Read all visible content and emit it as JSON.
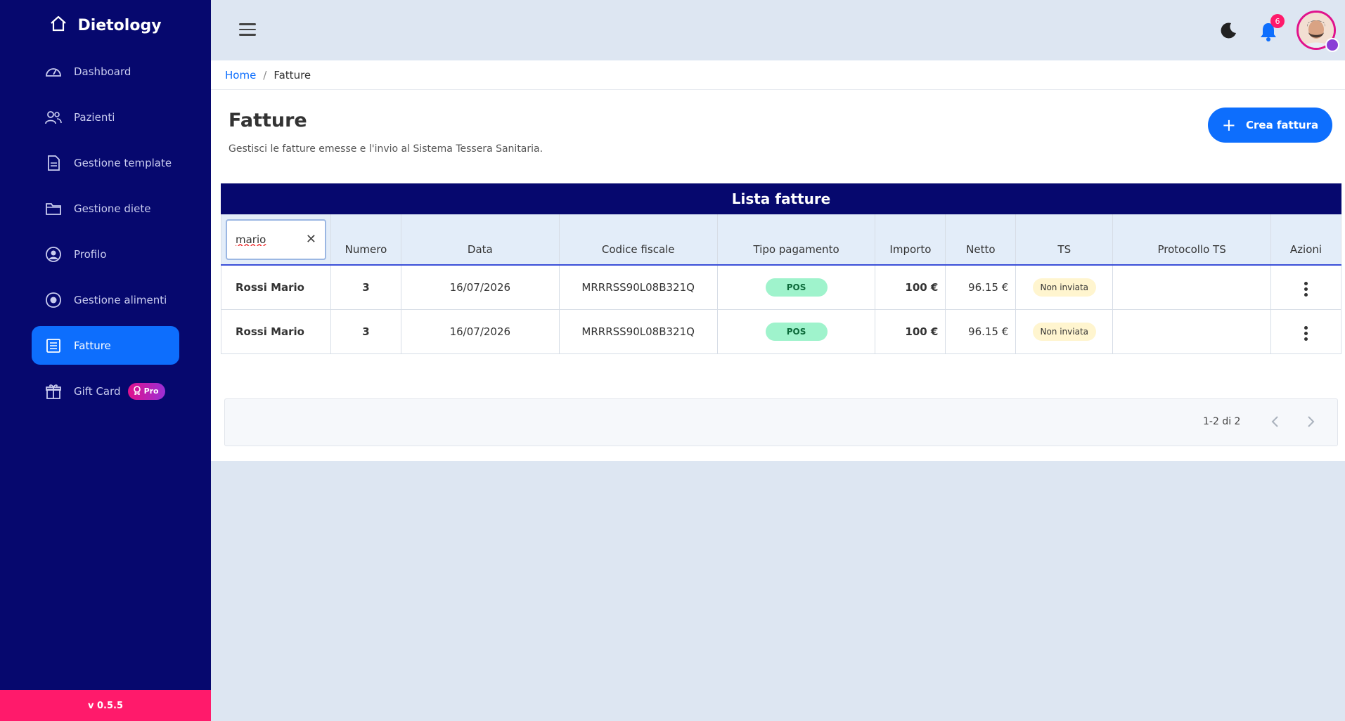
{
  "app": {
    "name": "Dietology",
    "version": "v 0.5.5"
  },
  "sidebar": {
    "items": [
      {
        "label": "Dashboard",
        "icon": "gauge-icon"
      },
      {
        "label": "Pazienti",
        "icon": "users-icon"
      },
      {
        "label": "Gestione template",
        "icon": "file-icon"
      },
      {
        "label": "Gestione diete",
        "icon": "folder-icon"
      },
      {
        "label": "Profilo",
        "icon": "user-circle-icon"
      },
      {
        "label": "Gestione alimenti",
        "icon": "food-icon"
      },
      {
        "label": "Fatture",
        "icon": "invoice-icon",
        "active": true
      },
      {
        "label": "Gift Card",
        "icon": "gift-icon",
        "badge": "Pro"
      }
    ]
  },
  "topbar": {
    "notification_count": "6"
  },
  "breadcrumb": {
    "home": "Home",
    "separator": "/",
    "current": "Fatture"
  },
  "page": {
    "title": "Fatture",
    "subtitle": "Gestisci le fatture emesse e l'invio al Sistema Tessera Sanitaria.",
    "create_label": "Crea fattura"
  },
  "table": {
    "title": "Lista fatture",
    "search_value": "mario",
    "headers": [
      "Numero",
      "Data",
      "Codice fiscale",
      "Tipo pagamento",
      "Importo",
      "Netto",
      "TS",
      "Protocollo TS",
      "Azioni"
    ],
    "rows": [
      {
        "name": "Rossi Mario",
        "numero": "3",
        "data": "16/07/2026",
        "cf": "MRRRSS90L08B321Q",
        "pagamento": "POS",
        "importo": "100 €",
        "netto": "96.15 €",
        "ts": "Non inviata",
        "protocollo": ""
      },
      {
        "name": "Rossi Mario",
        "numero": "3",
        "data": "16/07/2026",
        "cf": "MRRRSS90L08B321Q",
        "pagamento": "POS",
        "importo": "100 €",
        "netto": "96.15 €",
        "ts": "Non inviata",
        "protocollo": ""
      }
    ]
  },
  "pagination": {
    "info": "1-2 di 2"
  },
  "colors": {
    "sidebar": "#06086e",
    "primary": "#0d6efd",
    "version_bar": "#ff1a6b",
    "pill_pos": "#9ff3cc",
    "pill_ts": "#fff5cf"
  }
}
